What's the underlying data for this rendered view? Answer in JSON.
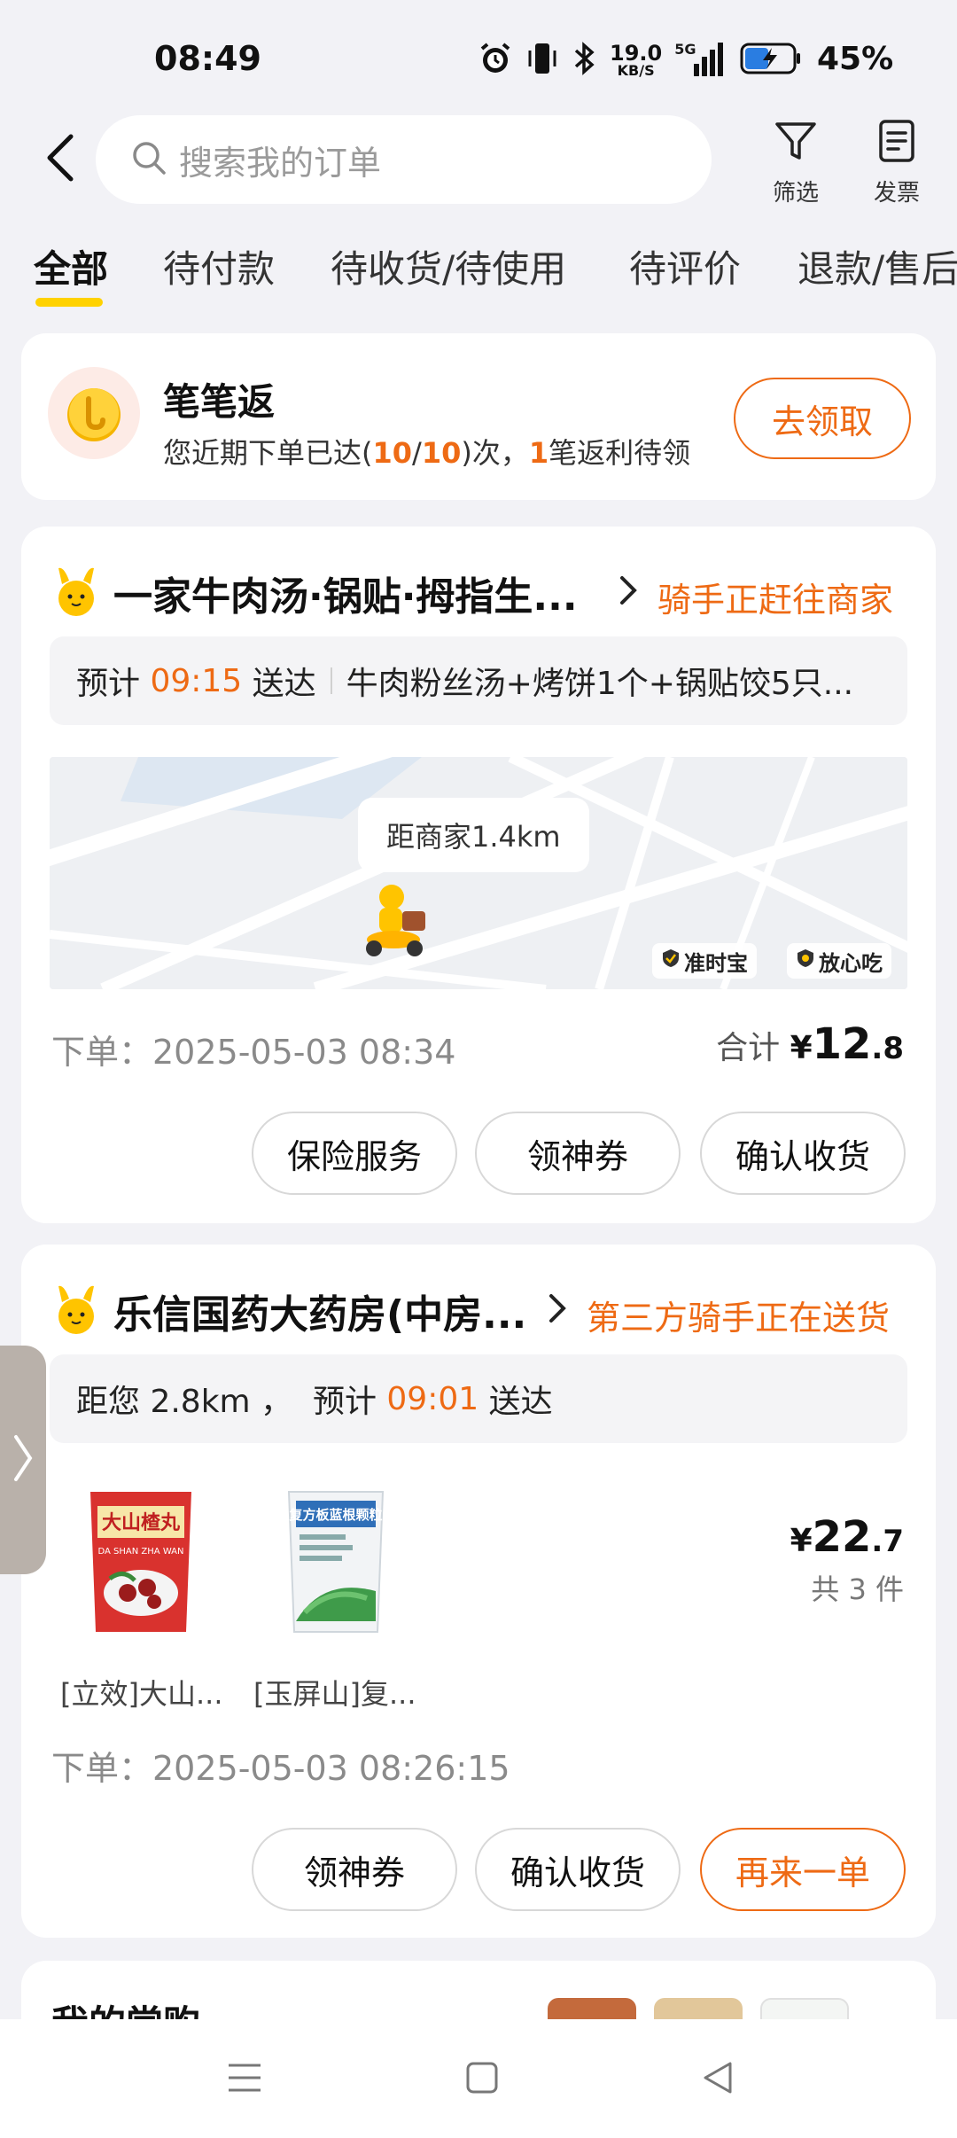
{
  "status_bar": {
    "time": "08:49",
    "net_speed_value": "19.0",
    "net_speed_unit": "KB/S",
    "signal": "5G",
    "battery": "45%",
    "icons": [
      "alarm-icon",
      "vibrate-icon",
      "bluetooth-icon",
      "signal-icon",
      "battery-icon"
    ]
  },
  "header": {
    "search_placeholder": "搜索我的订单",
    "filter_label": "筛选",
    "invoice_label": "发票"
  },
  "tabs": [
    "全部",
    "待付款",
    "待收货/待使用",
    "待评价",
    "退款/售后"
  ],
  "cashback": {
    "title": "笔笔返",
    "sub_prefix": "您近期下单已达(",
    "count": "10",
    "slash": "/",
    "total": "10",
    "sub_mid": ")次，",
    "pending": "1",
    "sub_suffix": "笔返利待领",
    "button": "去领取"
  },
  "orders": [
    {
      "shop": "一家牛肉汤·锅贴·拇指生...",
      "status": "骑手正赶往商家",
      "eta_prefix": "预计 ",
      "eta_time": "09:15",
      "eta_suffix": " 送达",
      "items_desc": "牛肉粉丝汤+烤饼1个+锅贴饺5只...",
      "map_bubble": "距商家1.4km",
      "badge1": "准时宝",
      "badge2": "放心吃",
      "order_time": "下单：2025-05-03 08:34",
      "total_label": "合计 ",
      "total_symbol": "¥",
      "total_int": "12",
      "total_dec": ".8",
      "buttons": [
        "保险服务",
        "领神券",
        "确认收货"
      ]
    },
    {
      "shop": "乐信国药大药房(中房...",
      "status": "第三方骑手正在送货",
      "eta_text_prefix": "距您 2.8km ，  预计 ",
      "eta_time": "09:01",
      "eta_suffix": " 送达",
      "products": [
        {
          "name": "[立效]大山...",
          "pack_label": "大山楂丸",
          "pack_sub": "DA SHAN ZHA WAN"
        },
        {
          "name": "[玉屏山]复...",
          "pack_label": "复方板蓝根颗粒"
        }
      ],
      "price_symbol": "¥",
      "price_int": "22",
      "price_dec": ".7",
      "count_text": "共 3 件",
      "order_time": "下单：2025-05-03 08:26:15",
      "buttons": [
        "领神券",
        "确认收货",
        "再来一单"
      ]
    }
  ],
  "frequent": {
    "title": "我的常购"
  },
  "colors": {
    "accent": "#ee6a14",
    "tab_underline": "#ffd200",
    "background": "#f2f2f6"
  }
}
